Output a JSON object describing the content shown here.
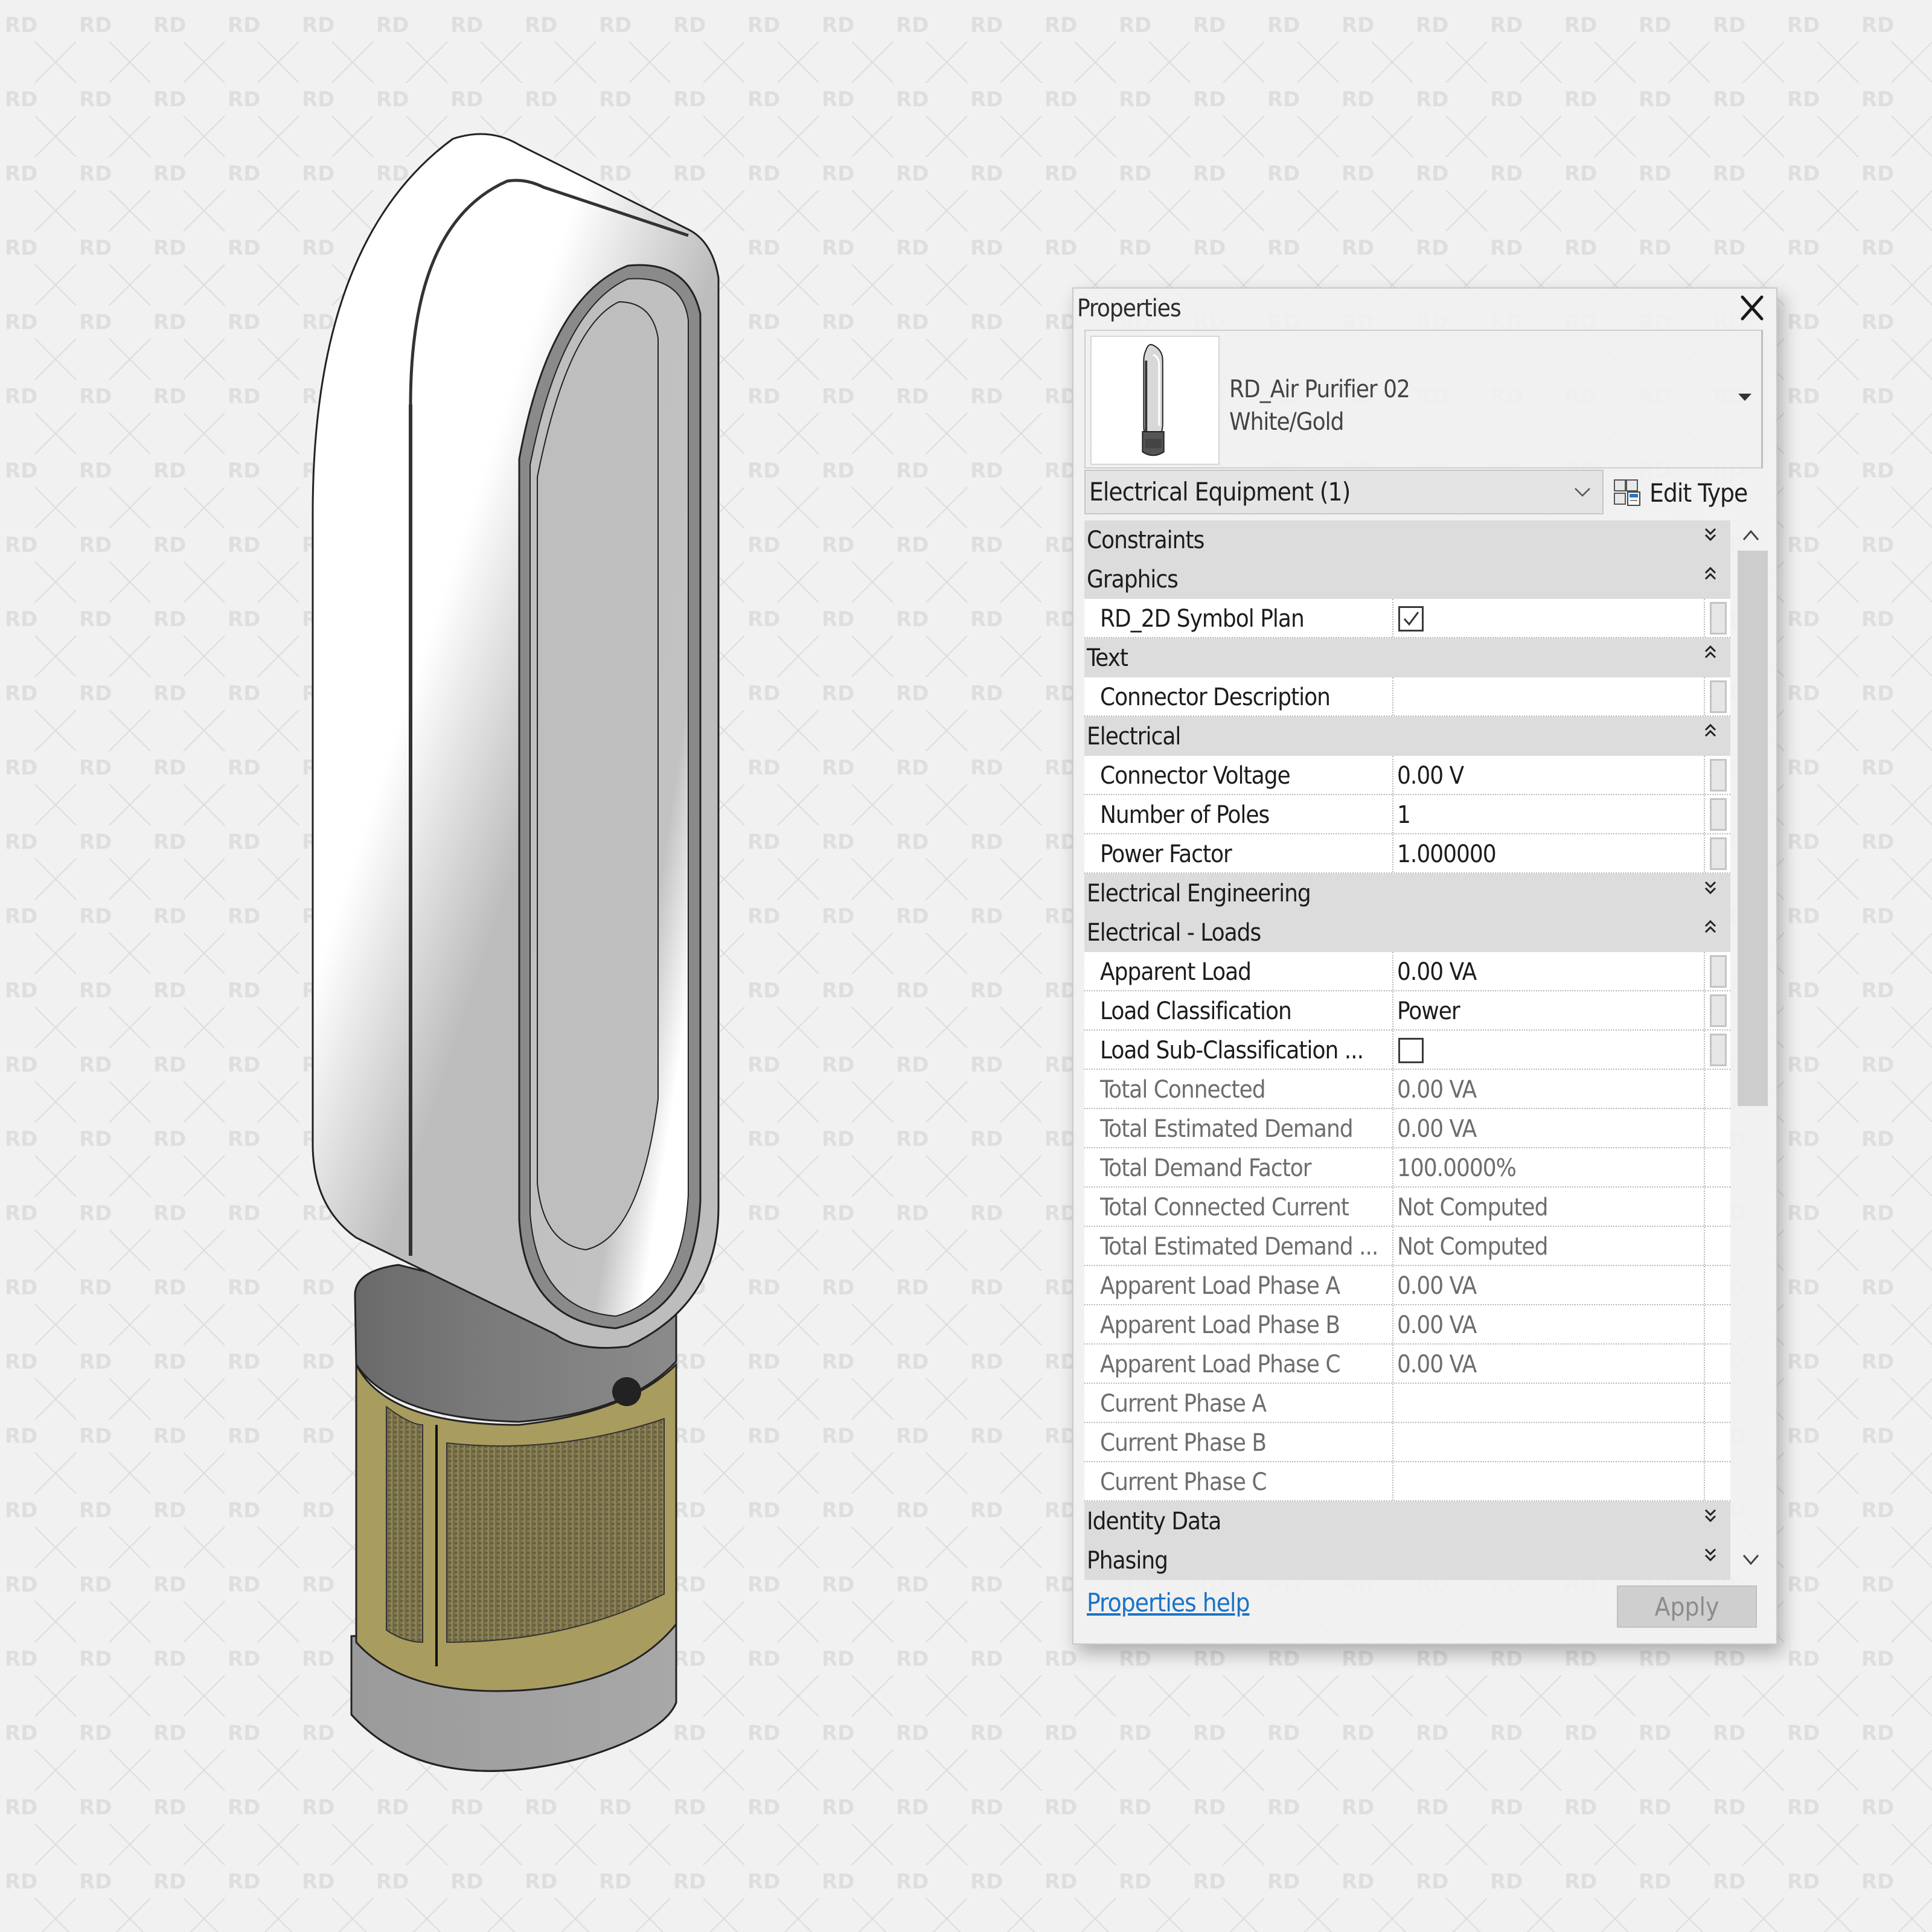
{
  "watermark": {
    "text": "RD"
  },
  "product": {
    "name": "air-purifier-fan",
    "colors": {
      "body": "#ffffff",
      "shadow": "#bcbcbc",
      "base": "#6f6f6f",
      "mesh": "#8a7f4d",
      "frame": "#a89c5f"
    }
  },
  "panel": {
    "title": "Properties",
    "type_selector": {
      "family": "RD_Air Purifier 02",
      "type": "White/Gold"
    },
    "category": "Electrical Equipment (1)",
    "edit_type_label": "Edit Type",
    "groups": [
      {
        "label": "Constraints",
        "state": "collapsed",
        "rows": []
      },
      {
        "label": "Graphics",
        "state": "expanded",
        "rows": [
          {
            "label": "RD_2D Symbol Plan",
            "kind": "checkbox",
            "checked": true,
            "editable": true
          }
        ]
      },
      {
        "label": "Text",
        "state": "expanded",
        "rows": [
          {
            "label": "Connector Description",
            "value": "",
            "editable": true
          }
        ]
      },
      {
        "label": "Electrical",
        "state": "expanded",
        "rows": [
          {
            "label": "Connector Voltage",
            "value": "0.00 V",
            "editable": true
          },
          {
            "label": "Number of Poles",
            "value": "1",
            "editable": true
          },
          {
            "label": "Power Factor",
            "value": "1.000000",
            "editable": true
          }
        ]
      },
      {
        "label": "Electrical Engineering",
        "state": "collapsed",
        "rows": []
      },
      {
        "label": "Electrical - Loads",
        "state": "expanded",
        "rows": [
          {
            "label": "Apparent Load",
            "value": "0.00 VA",
            "editable": true
          },
          {
            "label": "Load Classification",
            "value": "Power",
            "editable": true
          },
          {
            "label": "Load Sub-Classification ...",
            "kind": "checkbox",
            "checked": false,
            "editable": true
          },
          {
            "label": "Total Connected",
            "value": "0.00 VA",
            "editable": false
          },
          {
            "label": "Total Estimated Demand",
            "value": "0.00 VA",
            "editable": false
          },
          {
            "label": "Total Demand Factor",
            "value": "100.0000%",
            "editable": false
          },
          {
            "label": "Total Connected Current",
            "value": "Not Computed",
            "editable": false
          },
          {
            "label": "Total Estimated Demand ...",
            "value": "Not Computed",
            "editable": false
          },
          {
            "label": "Apparent Load Phase A",
            "value": "0.00 VA",
            "editable": false
          },
          {
            "label": "Apparent Load Phase B",
            "value": "0.00 VA",
            "editable": false
          },
          {
            "label": "Apparent Load Phase C",
            "value": "0.00 VA",
            "editable": false
          },
          {
            "label": "Current Phase A",
            "value": "",
            "editable": false
          },
          {
            "label": "Current Phase B",
            "value": "",
            "editable": false
          },
          {
            "label": "Current Phase C",
            "value": "",
            "editable": false
          }
        ]
      },
      {
        "label": "Identity Data",
        "state": "collapsed",
        "rows": []
      },
      {
        "label": "Phasing",
        "state": "collapsed",
        "rows": []
      }
    ],
    "help_link": "Properties help",
    "apply_label": "Apply",
    "apply_enabled": false,
    "link_color": "#1a73c8"
  }
}
